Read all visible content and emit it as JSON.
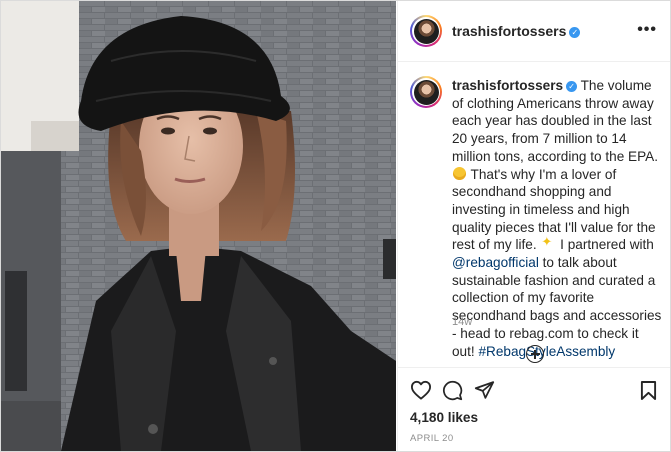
{
  "post": {
    "username": "trashisfortossers",
    "verified_mark": "✓",
    "more_options": "•••",
    "caption": {
      "author": "trashisfortossers",
      "part1": " The volume of clothing Americans throw away each year has doubled in the last 20 years, from 7 million to 14 million tons, according to the EPA. ",
      "part2": " That's why I'm a lover of secondhand shopping and investing in timeless and high quality pieces that I'll value for the rest of my life. ",
      "part3": " I partnered with ",
      "mention": "@rebagofficial",
      "part4": " to talk about sustainable fashion and curated a collection of my favorite secondhand bags and accessories - head to rebag.com to check it out! ",
      "hashtag": "#RebagStyleAssembly",
      "emoji1": "scream-face-emoji",
      "emoji2": "sparkles-emoji"
    },
    "time_ago": "14w",
    "likes": "4,180 likes",
    "date": "APRIL 20"
  },
  "icons": {
    "like": "heart-icon",
    "comment": "comment-bubble-icon",
    "share": "paper-plane-icon",
    "save": "bookmark-icon",
    "add": "plus-circle-icon",
    "more": "more-horizontal-icon",
    "verified": "verified-badge-icon"
  },
  "colors": {
    "verified": "#3897f0",
    "link": "#00376b",
    "muted": "#8e8e8e",
    "text": "#262626",
    "border": "#dbdbdb"
  }
}
